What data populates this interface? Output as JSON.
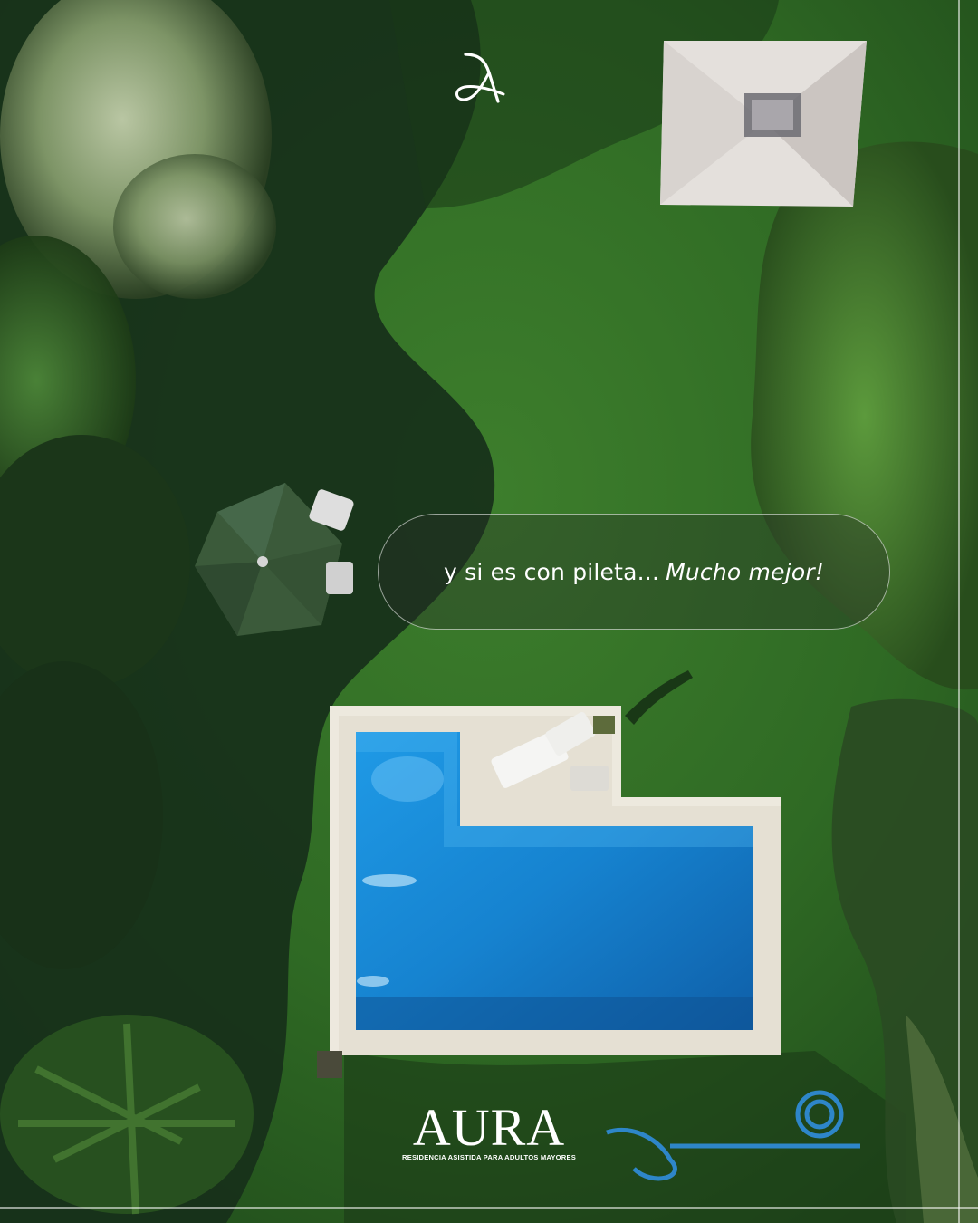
{
  "caption": {
    "plain": "y si es con pileta...",
    "emphasis": "Mucho mejor!"
  },
  "brand": {
    "name": "AURA",
    "tagline": "RESIDENCIA ASISTIDA PARA ADULTOS MAYORES"
  },
  "colors": {
    "grass": "#2f6a27",
    "pool_water": "#1a8fd8",
    "pool_deck": "#e6e2d6",
    "foliage": "#1e3a1a",
    "text": "#ffffff"
  }
}
